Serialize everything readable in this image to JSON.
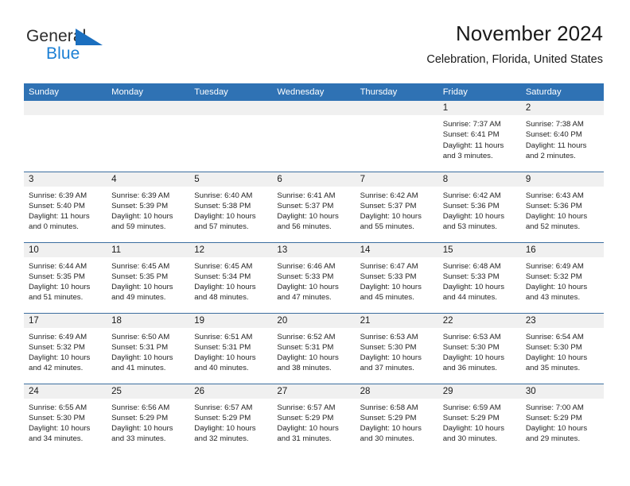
{
  "logo": {
    "word1": "General",
    "word2": "Blue",
    "triangle_color": "#1b6fbf"
  },
  "header": {
    "title": "November 2024",
    "location": "Celebration, Florida, United States"
  },
  "colors": {
    "header_blue": "#2f72b4",
    "row_separator": "#3c6e9f",
    "daynum_band": "#f0f0f0",
    "logo_blue": "#1b7fd4"
  },
  "weekday_headers": [
    "Sunday",
    "Monday",
    "Tuesday",
    "Wednesday",
    "Thursday",
    "Friday",
    "Saturday"
  ],
  "weeks": [
    [
      {
        "day": "",
        "empty": true
      },
      {
        "day": "",
        "empty": true
      },
      {
        "day": "",
        "empty": true
      },
      {
        "day": "",
        "empty": true
      },
      {
        "day": "",
        "empty": true
      },
      {
        "day": "1",
        "sunrise": "Sunrise: 7:37 AM",
        "sunset": "Sunset: 6:41 PM",
        "daylight1": "Daylight: 11 hours",
        "daylight2": "and 3 minutes."
      },
      {
        "day": "2",
        "sunrise": "Sunrise: 7:38 AM",
        "sunset": "Sunset: 6:40 PM",
        "daylight1": "Daylight: 11 hours",
        "daylight2": "and 2 minutes."
      }
    ],
    [
      {
        "day": "3",
        "sunrise": "Sunrise: 6:39 AM",
        "sunset": "Sunset: 5:40 PM",
        "daylight1": "Daylight: 11 hours",
        "daylight2": "and 0 minutes."
      },
      {
        "day": "4",
        "sunrise": "Sunrise: 6:39 AM",
        "sunset": "Sunset: 5:39 PM",
        "daylight1": "Daylight: 10 hours",
        "daylight2": "and 59 minutes."
      },
      {
        "day": "5",
        "sunrise": "Sunrise: 6:40 AM",
        "sunset": "Sunset: 5:38 PM",
        "daylight1": "Daylight: 10 hours",
        "daylight2": "and 57 minutes."
      },
      {
        "day": "6",
        "sunrise": "Sunrise: 6:41 AM",
        "sunset": "Sunset: 5:37 PM",
        "daylight1": "Daylight: 10 hours",
        "daylight2": "and 56 minutes."
      },
      {
        "day": "7",
        "sunrise": "Sunrise: 6:42 AM",
        "sunset": "Sunset: 5:37 PM",
        "daylight1": "Daylight: 10 hours",
        "daylight2": "and 55 minutes."
      },
      {
        "day": "8",
        "sunrise": "Sunrise: 6:42 AM",
        "sunset": "Sunset: 5:36 PM",
        "daylight1": "Daylight: 10 hours",
        "daylight2": "and 53 minutes."
      },
      {
        "day": "9",
        "sunrise": "Sunrise: 6:43 AM",
        "sunset": "Sunset: 5:36 PM",
        "daylight1": "Daylight: 10 hours",
        "daylight2": "and 52 minutes."
      }
    ],
    [
      {
        "day": "10",
        "sunrise": "Sunrise: 6:44 AM",
        "sunset": "Sunset: 5:35 PM",
        "daylight1": "Daylight: 10 hours",
        "daylight2": "and 51 minutes."
      },
      {
        "day": "11",
        "sunrise": "Sunrise: 6:45 AM",
        "sunset": "Sunset: 5:35 PM",
        "daylight1": "Daylight: 10 hours",
        "daylight2": "and 49 minutes."
      },
      {
        "day": "12",
        "sunrise": "Sunrise: 6:45 AM",
        "sunset": "Sunset: 5:34 PM",
        "daylight1": "Daylight: 10 hours",
        "daylight2": "and 48 minutes."
      },
      {
        "day": "13",
        "sunrise": "Sunrise: 6:46 AM",
        "sunset": "Sunset: 5:33 PM",
        "daylight1": "Daylight: 10 hours",
        "daylight2": "and 47 minutes."
      },
      {
        "day": "14",
        "sunrise": "Sunrise: 6:47 AM",
        "sunset": "Sunset: 5:33 PM",
        "daylight1": "Daylight: 10 hours",
        "daylight2": "and 45 minutes."
      },
      {
        "day": "15",
        "sunrise": "Sunrise: 6:48 AM",
        "sunset": "Sunset: 5:33 PM",
        "daylight1": "Daylight: 10 hours",
        "daylight2": "and 44 minutes."
      },
      {
        "day": "16",
        "sunrise": "Sunrise: 6:49 AM",
        "sunset": "Sunset: 5:32 PM",
        "daylight1": "Daylight: 10 hours",
        "daylight2": "and 43 minutes."
      }
    ],
    [
      {
        "day": "17",
        "sunrise": "Sunrise: 6:49 AM",
        "sunset": "Sunset: 5:32 PM",
        "daylight1": "Daylight: 10 hours",
        "daylight2": "and 42 minutes."
      },
      {
        "day": "18",
        "sunrise": "Sunrise: 6:50 AM",
        "sunset": "Sunset: 5:31 PM",
        "daylight1": "Daylight: 10 hours",
        "daylight2": "and 41 minutes."
      },
      {
        "day": "19",
        "sunrise": "Sunrise: 6:51 AM",
        "sunset": "Sunset: 5:31 PM",
        "daylight1": "Daylight: 10 hours",
        "daylight2": "and 40 minutes."
      },
      {
        "day": "20",
        "sunrise": "Sunrise: 6:52 AM",
        "sunset": "Sunset: 5:31 PM",
        "daylight1": "Daylight: 10 hours",
        "daylight2": "and 38 minutes."
      },
      {
        "day": "21",
        "sunrise": "Sunrise: 6:53 AM",
        "sunset": "Sunset: 5:30 PM",
        "daylight1": "Daylight: 10 hours",
        "daylight2": "and 37 minutes."
      },
      {
        "day": "22",
        "sunrise": "Sunrise: 6:53 AM",
        "sunset": "Sunset: 5:30 PM",
        "daylight1": "Daylight: 10 hours",
        "daylight2": "and 36 minutes."
      },
      {
        "day": "23",
        "sunrise": "Sunrise: 6:54 AM",
        "sunset": "Sunset: 5:30 PM",
        "daylight1": "Daylight: 10 hours",
        "daylight2": "and 35 minutes."
      }
    ],
    [
      {
        "day": "24",
        "sunrise": "Sunrise: 6:55 AM",
        "sunset": "Sunset: 5:30 PM",
        "daylight1": "Daylight: 10 hours",
        "daylight2": "and 34 minutes."
      },
      {
        "day": "25",
        "sunrise": "Sunrise: 6:56 AM",
        "sunset": "Sunset: 5:29 PM",
        "daylight1": "Daylight: 10 hours",
        "daylight2": "and 33 minutes."
      },
      {
        "day": "26",
        "sunrise": "Sunrise: 6:57 AM",
        "sunset": "Sunset: 5:29 PM",
        "daylight1": "Daylight: 10 hours",
        "daylight2": "and 32 minutes."
      },
      {
        "day": "27",
        "sunrise": "Sunrise: 6:57 AM",
        "sunset": "Sunset: 5:29 PM",
        "daylight1": "Daylight: 10 hours",
        "daylight2": "and 31 minutes."
      },
      {
        "day": "28",
        "sunrise": "Sunrise: 6:58 AM",
        "sunset": "Sunset: 5:29 PM",
        "daylight1": "Daylight: 10 hours",
        "daylight2": "and 30 minutes."
      },
      {
        "day": "29",
        "sunrise": "Sunrise: 6:59 AM",
        "sunset": "Sunset: 5:29 PM",
        "daylight1": "Daylight: 10 hours",
        "daylight2": "and 30 minutes."
      },
      {
        "day": "30",
        "sunrise": "Sunrise: 7:00 AM",
        "sunset": "Sunset: 5:29 PM",
        "daylight1": "Daylight: 10 hours",
        "daylight2": "and 29 minutes."
      }
    ]
  ]
}
